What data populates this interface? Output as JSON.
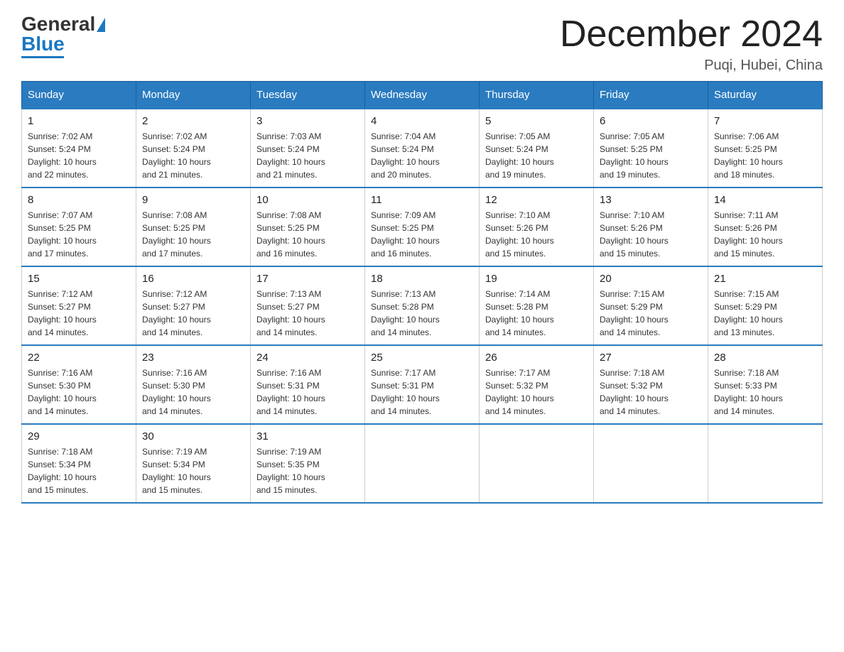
{
  "header": {
    "logo_general": "General",
    "logo_blue": "Blue",
    "title": "December 2024",
    "location": "Puqi, Hubei, China"
  },
  "days_of_week": [
    "Sunday",
    "Monday",
    "Tuesday",
    "Wednesday",
    "Thursday",
    "Friday",
    "Saturday"
  ],
  "weeks": [
    [
      {
        "day": "1",
        "info": "Sunrise: 7:02 AM\nSunset: 5:24 PM\nDaylight: 10 hours\nand 22 minutes."
      },
      {
        "day": "2",
        "info": "Sunrise: 7:02 AM\nSunset: 5:24 PM\nDaylight: 10 hours\nand 21 minutes."
      },
      {
        "day": "3",
        "info": "Sunrise: 7:03 AM\nSunset: 5:24 PM\nDaylight: 10 hours\nand 21 minutes."
      },
      {
        "day": "4",
        "info": "Sunrise: 7:04 AM\nSunset: 5:24 PM\nDaylight: 10 hours\nand 20 minutes."
      },
      {
        "day": "5",
        "info": "Sunrise: 7:05 AM\nSunset: 5:24 PM\nDaylight: 10 hours\nand 19 minutes."
      },
      {
        "day": "6",
        "info": "Sunrise: 7:05 AM\nSunset: 5:25 PM\nDaylight: 10 hours\nand 19 minutes."
      },
      {
        "day": "7",
        "info": "Sunrise: 7:06 AM\nSunset: 5:25 PM\nDaylight: 10 hours\nand 18 minutes."
      }
    ],
    [
      {
        "day": "8",
        "info": "Sunrise: 7:07 AM\nSunset: 5:25 PM\nDaylight: 10 hours\nand 17 minutes."
      },
      {
        "day": "9",
        "info": "Sunrise: 7:08 AM\nSunset: 5:25 PM\nDaylight: 10 hours\nand 17 minutes."
      },
      {
        "day": "10",
        "info": "Sunrise: 7:08 AM\nSunset: 5:25 PM\nDaylight: 10 hours\nand 16 minutes."
      },
      {
        "day": "11",
        "info": "Sunrise: 7:09 AM\nSunset: 5:25 PM\nDaylight: 10 hours\nand 16 minutes."
      },
      {
        "day": "12",
        "info": "Sunrise: 7:10 AM\nSunset: 5:26 PM\nDaylight: 10 hours\nand 15 minutes."
      },
      {
        "day": "13",
        "info": "Sunrise: 7:10 AM\nSunset: 5:26 PM\nDaylight: 10 hours\nand 15 minutes."
      },
      {
        "day": "14",
        "info": "Sunrise: 7:11 AM\nSunset: 5:26 PM\nDaylight: 10 hours\nand 15 minutes."
      }
    ],
    [
      {
        "day": "15",
        "info": "Sunrise: 7:12 AM\nSunset: 5:27 PM\nDaylight: 10 hours\nand 14 minutes."
      },
      {
        "day": "16",
        "info": "Sunrise: 7:12 AM\nSunset: 5:27 PM\nDaylight: 10 hours\nand 14 minutes."
      },
      {
        "day": "17",
        "info": "Sunrise: 7:13 AM\nSunset: 5:27 PM\nDaylight: 10 hours\nand 14 minutes."
      },
      {
        "day": "18",
        "info": "Sunrise: 7:13 AM\nSunset: 5:28 PM\nDaylight: 10 hours\nand 14 minutes."
      },
      {
        "day": "19",
        "info": "Sunrise: 7:14 AM\nSunset: 5:28 PM\nDaylight: 10 hours\nand 14 minutes."
      },
      {
        "day": "20",
        "info": "Sunrise: 7:15 AM\nSunset: 5:29 PM\nDaylight: 10 hours\nand 14 minutes."
      },
      {
        "day": "21",
        "info": "Sunrise: 7:15 AM\nSunset: 5:29 PM\nDaylight: 10 hours\nand 13 minutes."
      }
    ],
    [
      {
        "day": "22",
        "info": "Sunrise: 7:16 AM\nSunset: 5:30 PM\nDaylight: 10 hours\nand 14 minutes."
      },
      {
        "day": "23",
        "info": "Sunrise: 7:16 AM\nSunset: 5:30 PM\nDaylight: 10 hours\nand 14 minutes."
      },
      {
        "day": "24",
        "info": "Sunrise: 7:16 AM\nSunset: 5:31 PM\nDaylight: 10 hours\nand 14 minutes."
      },
      {
        "day": "25",
        "info": "Sunrise: 7:17 AM\nSunset: 5:31 PM\nDaylight: 10 hours\nand 14 minutes."
      },
      {
        "day": "26",
        "info": "Sunrise: 7:17 AM\nSunset: 5:32 PM\nDaylight: 10 hours\nand 14 minutes."
      },
      {
        "day": "27",
        "info": "Sunrise: 7:18 AM\nSunset: 5:32 PM\nDaylight: 10 hours\nand 14 minutes."
      },
      {
        "day": "28",
        "info": "Sunrise: 7:18 AM\nSunset: 5:33 PM\nDaylight: 10 hours\nand 14 minutes."
      }
    ],
    [
      {
        "day": "29",
        "info": "Sunrise: 7:18 AM\nSunset: 5:34 PM\nDaylight: 10 hours\nand 15 minutes."
      },
      {
        "day": "30",
        "info": "Sunrise: 7:19 AM\nSunset: 5:34 PM\nDaylight: 10 hours\nand 15 minutes."
      },
      {
        "day": "31",
        "info": "Sunrise: 7:19 AM\nSunset: 5:35 PM\nDaylight: 10 hours\nand 15 minutes."
      },
      {
        "day": "",
        "info": ""
      },
      {
        "day": "",
        "info": ""
      },
      {
        "day": "",
        "info": ""
      },
      {
        "day": "",
        "info": ""
      }
    ]
  ]
}
